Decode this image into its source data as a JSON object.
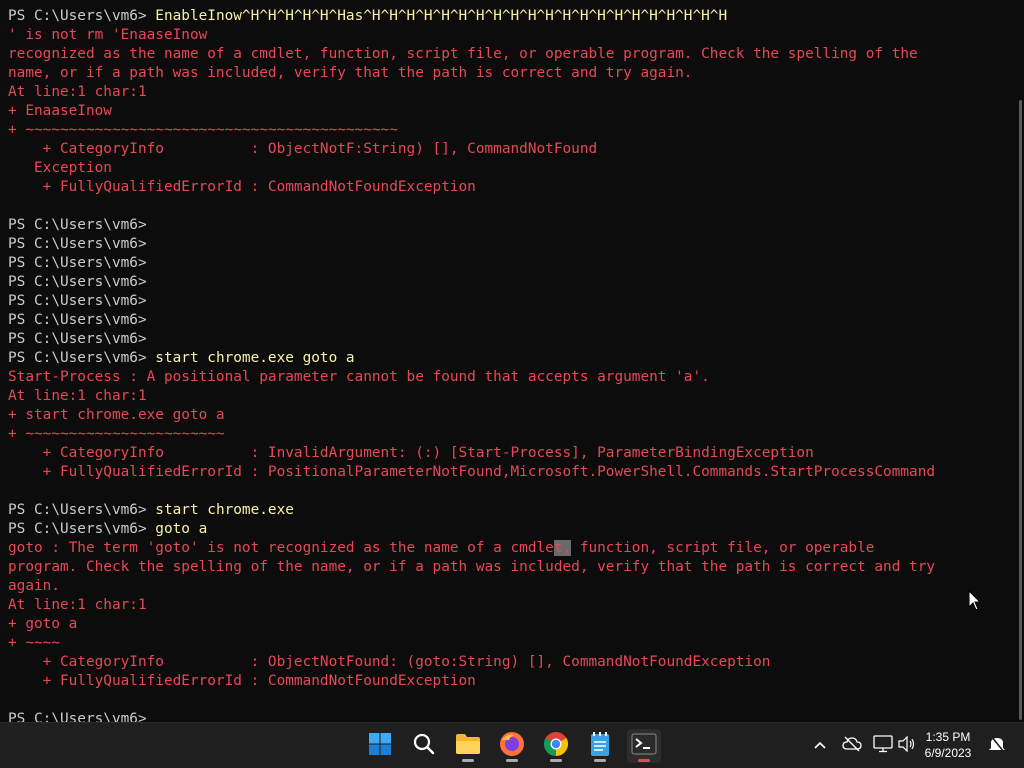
{
  "terminal": {
    "prompt": "PS C:\\Users\\vm6> ",
    "l1_cmd": "EnableInow^H^H^H^H^H^Has^H^H^H^H^H^H^H^H^H^H^H^H^H^H^H^H^H^H^H^H^H",
    "l2": "' is not rm 'EnaaseInow",
    "l3": "recognized as the name of a cmdlet, function, script file, or operable program. Check the spelling of the",
    "l4": "name, or if a path was included, verify that the path is correct and try again.",
    "l5": "At line:1 char:1",
    "l6": "+ EnaaseInow",
    "l7": "+ ~~~~~~~~~~~~~~~~~~~~~~~~~~~~~~~~~~~~~~~~~~~",
    "l8": "    + CategoryInfo          : ObjectNotF:String) [], CommandNotFound",
    "l9": "   Exception",
    "l10": "    + FullyQualifiedErrorId : CommandNotFoundException",
    "cmd_start_goto": "start chrome.exe goto a",
    "e1": "Start-Process : A positional parameter cannot be found that accepts argument 'a'.",
    "e2": "At line:1 char:1",
    "e3": "+ start chrome.exe goto a",
    "e4": "+ ~~~~~~~~~~~~~~~~~~~~~~~",
    "e5": "    + CategoryInfo          : InvalidArgument: (:) [Start-Process], ParameterBindingException",
    "e6": "    + FullyQualifiedErrorId : PositionalParameterNotFound,Microsoft.PowerShell.Commands.StartProcessCommand",
    "cmd_start": "start chrome.exe",
    "cmd_goto": "goto a",
    "g1_pre": "goto : The term 'goto' is not recognized as the name of a cmdle",
    "g1_sel": "t,",
    "g1_post": " function, script file, or operable",
    "g2": "program. Check the spelling of the name, or if a path was included, verify that the path is correct and try",
    "g3": "again.",
    "g4": "At line:1 char:1",
    "g5": "+ goto a",
    "g6": "+ ~~~~",
    "g7": "    + CategoryInfo          : ObjectNotFound: (goto:String) [], CommandNotFoundException",
    "g8": "    + FullyQualifiedErrorId : CommandNotFoundException",
    "last_prompt": "PS C:\\Users\\vm6>"
  },
  "taskbar": {
    "time": "1:35 PM",
    "date": "6/9/2023"
  },
  "icons": [
    "start-icon",
    "search-icon",
    "file-explorer-icon",
    "firefox-icon",
    "chrome-icon",
    "notepad-icon",
    "terminal-icon",
    "chevron-up-icon",
    "cloud-off-icon",
    "network-icon",
    "volume-icon",
    "notification-icon"
  ],
  "colors": {
    "error": "#e74856",
    "command": "#f9f1a5",
    "text": "#cccccc",
    "background": "#0c0c0c",
    "taskbar": "#1f1f1f"
  }
}
